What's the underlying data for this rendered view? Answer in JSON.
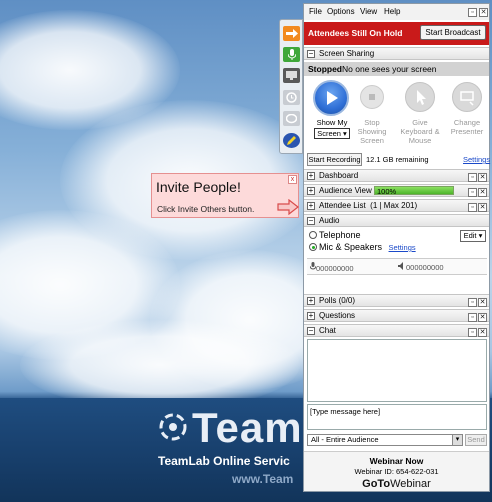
{
  "background": {
    "logo_text": "Team",
    "subtitle": "TeamLab Online Servic",
    "url": "www.Team"
  },
  "invite_popup": {
    "title": "Invite People!",
    "message": "Click Invite Others button.",
    "close_glyph": "x"
  },
  "menu": {
    "items": [
      "File",
      "Options",
      "View",
      "Help"
    ]
  },
  "status": {
    "on_hold": "Attendees Still On Hold",
    "start_broadcast": "Start Broadcast"
  },
  "screen_sharing": {
    "title": "Screen Sharing",
    "state": "Stopped",
    "state_detail": "No one sees your screen",
    "show_label": "Show My",
    "show_select": "Screen",
    "stop_label": "Stop Showing Screen",
    "keyboard_label": "Give Keyboard & Mouse",
    "presenter_label": "Change Presenter",
    "record_button": "Start Recording",
    "storage": "12.1 GB remaining",
    "settings_link": "Settings"
  },
  "sections": {
    "dashboard": "Dashboard",
    "audience_view": "Audience View",
    "audience_value": "100%",
    "audience_fraction": 1.0,
    "attendee_list": "Attendee List",
    "attendee_count": "(1 | Max 201)",
    "audio": "Audio",
    "polls": "Polls (0/0)",
    "questions": "Questions",
    "chat": "Chat"
  },
  "audio": {
    "telephone": "Telephone",
    "mic": "Mic & Speakers",
    "settings_link": "Settings",
    "edit_button": "Edit",
    "mic_level": "000000000",
    "speaker_level": "000000000"
  },
  "chat": {
    "placeholder": "[Type message here]",
    "audience_option": "All - Entire Audience",
    "send": "Send"
  },
  "footer": {
    "webinar_now": "Webinar Now",
    "webinar_id": "Webinar ID: 654-622-031",
    "brand_bold": "GoTo",
    "brand_light": "Webinar"
  },
  "colors": {
    "on_hold_bar": "#c91a1a",
    "play_button": "#2f6fd6",
    "progress": "#4db52a"
  }
}
